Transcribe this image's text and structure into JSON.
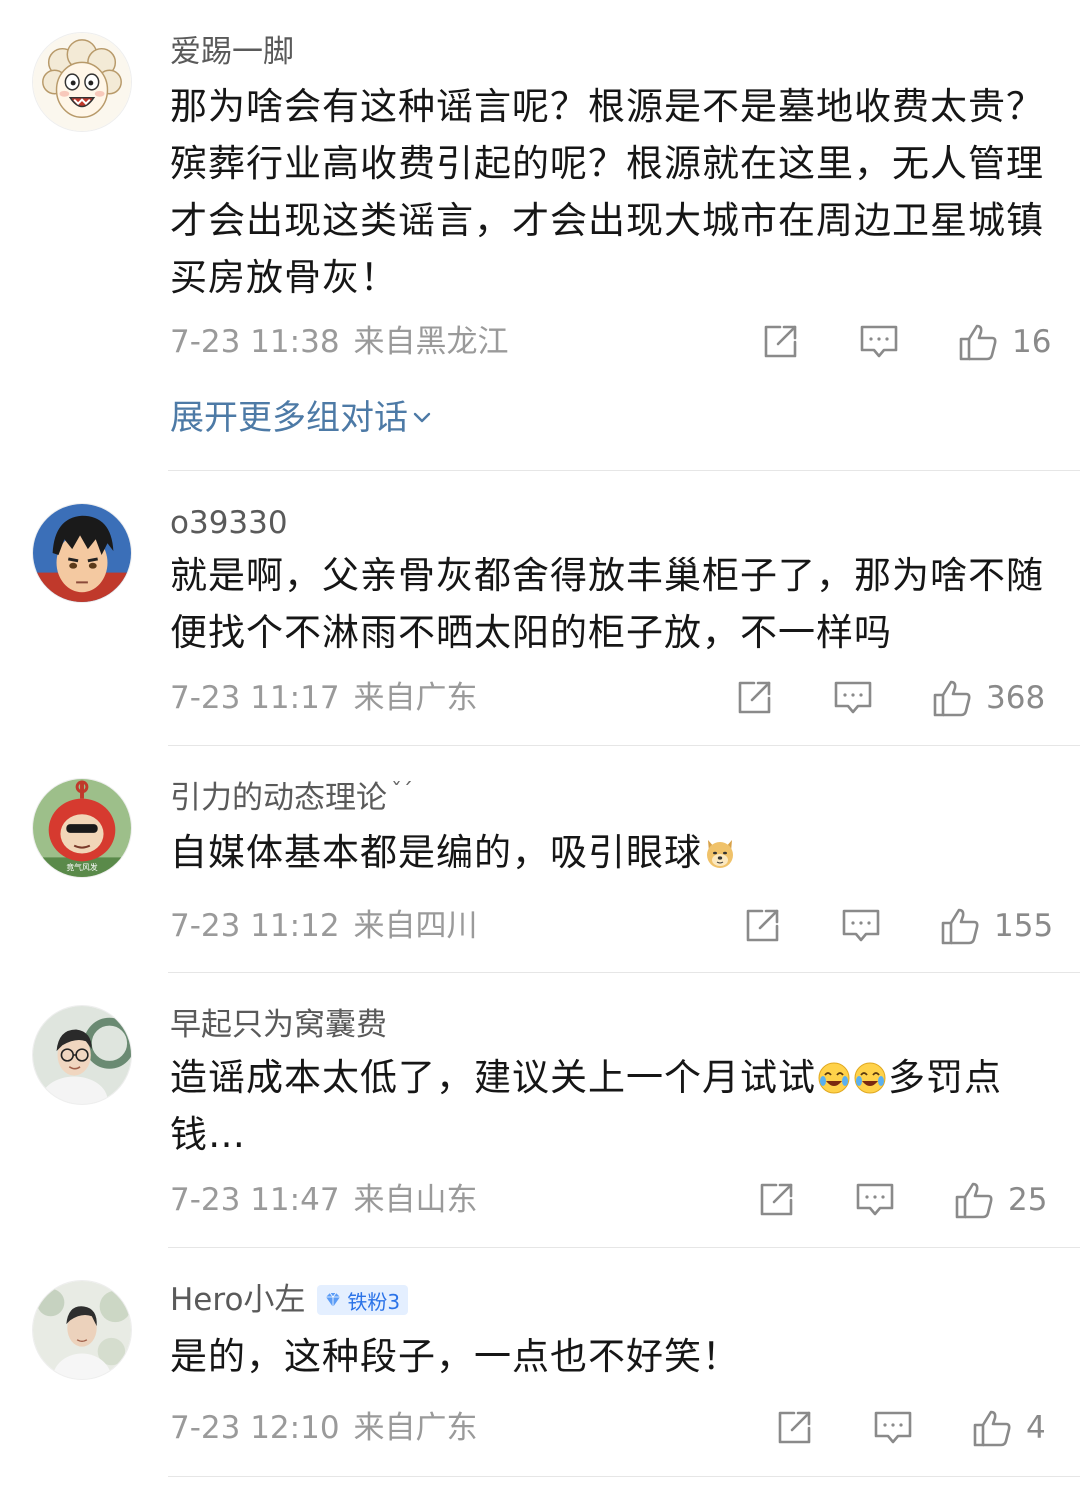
{
  "comments": [
    {
      "username": "爱踢一脚",
      "content": "那为啥会有这种谣言呢？根源是不是墓地收费太贵？殡葬行业高收费引起的呢？根源就在这里，无人管理  才会出现这类谣言，才会出现大城市在周边卫星城镇买房放骨灰！",
      "time": "7-23 11:38",
      "location": "来自黑龙江",
      "likes": "16",
      "expand_label": "展开更多组对话"
    },
    {
      "username": "o39330",
      "content": "就是啊，父亲骨灰都舍得放丰巢柜子了，那为啥不随便找个不淋雨不晒太阳的柜子放，不一样吗",
      "time": "7-23 11:17",
      "location": "来自广东",
      "likes": "368"
    },
    {
      "username": "引力的动态理论",
      "name_suffix": "ˇˊ",
      "content": "自媒体基本都是编的，吸引眼球",
      "content_emoji": "doge-emoji",
      "time": "7-23 11:12",
      "location": "来自四川",
      "likes": "155"
    },
    {
      "username": "早起只为窝囊费",
      "content_part1": "造谣成本太低了，建议关上一个月试试",
      "content_part2": "多罚点钱…",
      "content_emoji": "crying-laughing-emoji",
      "time": "7-23 11:47",
      "location": "来自山东",
      "likes": "25"
    },
    {
      "username": "Hero小左",
      "badge": "铁粉3",
      "content": "是的，这种段子，一点也不好笑！",
      "time": "7-23 12:10",
      "location": "来自广东",
      "likes": "4"
    }
  ],
  "colors": {
    "text": "#161616",
    "meta": "#9a9a9a",
    "link": "#4d7aa6",
    "badge_bg": "#e4efff",
    "badge_text": "#2b73e8",
    "divider": "#e6e6e6"
  }
}
